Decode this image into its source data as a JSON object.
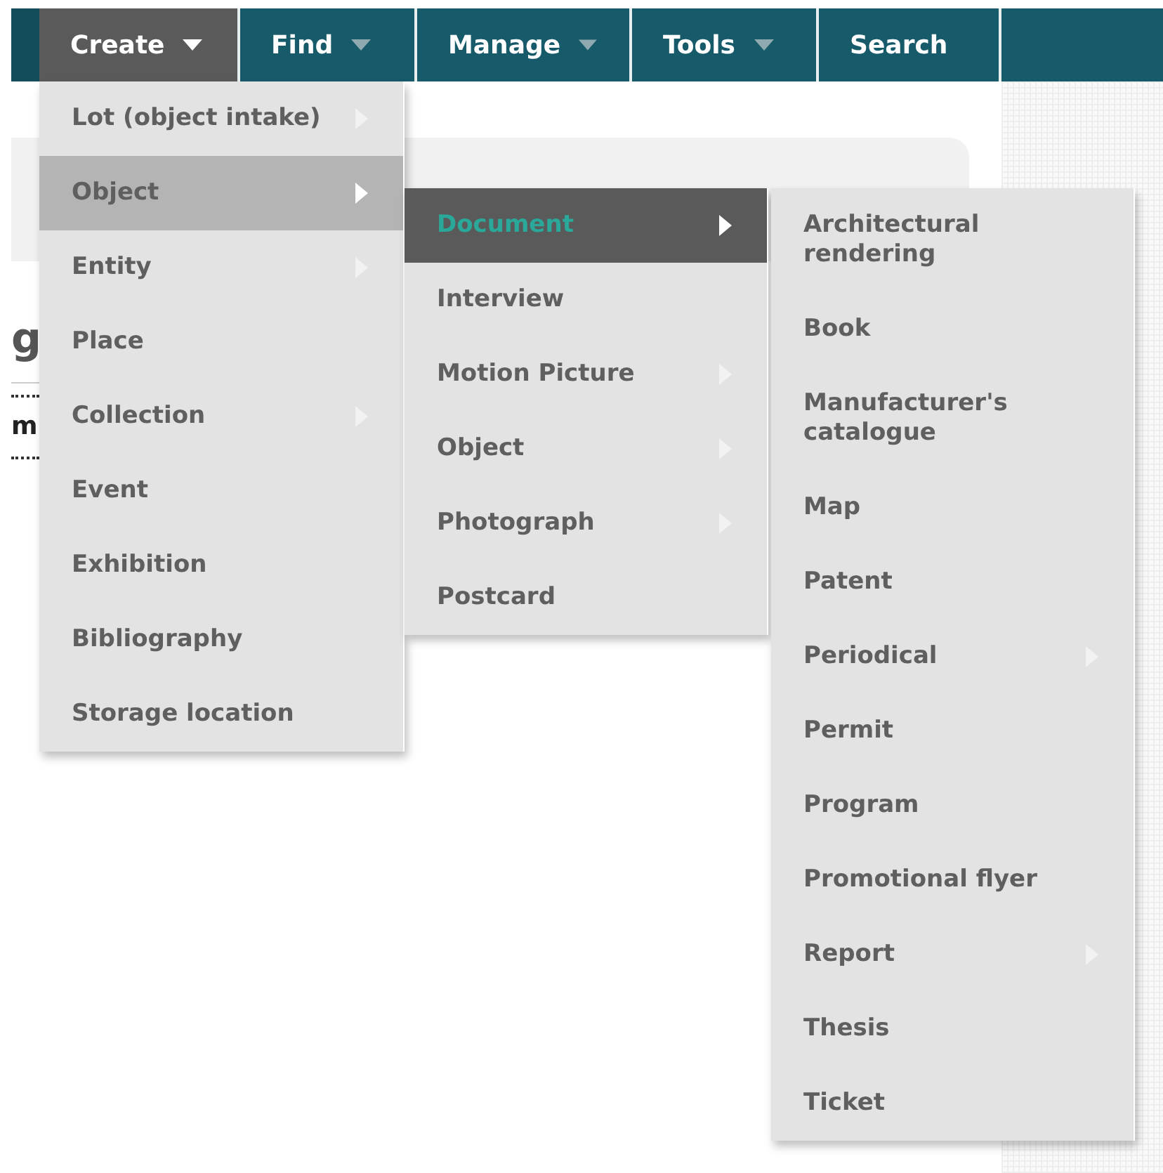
{
  "nav": {
    "tabs": [
      {
        "label": "Create",
        "selected": true,
        "dropdown": true
      },
      {
        "label": "Find",
        "selected": false,
        "dropdown": true
      },
      {
        "label": "Manage",
        "selected": false,
        "dropdown": true
      },
      {
        "label": "Tools",
        "selected": false,
        "dropdown": true
      },
      {
        "label": "Search",
        "selected": false,
        "dropdown": false
      }
    ]
  },
  "background": {
    "heading_fragment": "g",
    "label_fragment": "m"
  },
  "menus": [
    {
      "items": [
        {
          "label": "Lot (object intake)",
          "submenu": true,
          "selected": false
        },
        {
          "label": "Object",
          "submenu": true,
          "selected": true
        },
        {
          "label": "Entity",
          "submenu": true,
          "selected": false
        },
        {
          "label": "Place",
          "submenu": false,
          "selected": false
        },
        {
          "label": "Collection",
          "submenu": true,
          "selected": false
        },
        {
          "label": "Event",
          "submenu": false,
          "selected": false
        },
        {
          "label": "Exhibition",
          "submenu": false,
          "selected": false
        },
        {
          "label": "Bibliography",
          "submenu": false,
          "selected": false
        },
        {
          "label": "Storage location",
          "submenu": false,
          "selected": false
        }
      ]
    },
    {
      "items": [
        {
          "label": "Document",
          "submenu": true,
          "selected": true
        },
        {
          "label": "Interview",
          "submenu": false,
          "selected": false
        },
        {
          "label": "Motion Picture",
          "submenu": true,
          "selected": false
        },
        {
          "label": "Object",
          "submenu": true,
          "selected": false
        },
        {
          "label": "Photograph",
          "submenu": true,
          "selected": false
        },
        {
          "label": "Postcard",
          "submenu": false,
          "selected": false
        }
      ]
    },
    {
      "items": [
        {
          "label": "Architectural rendering",
          "submenu": false,
          "selected": false
        },
        {
          "label": "Book",
          "submenu": false,
          "selected": false
        },
        {
          "label": "Manufacturer's catalogue",
          "submenu": false,
          "selected": false
        },
        {
          "label": "Map",
          "submenu": false,
          "selected": false
        },
        {
          "label": "Patent",
          "submenu": false,
          "selected": false
        },
        {
          "label": "Periodical",
          "submenu": true,
          "selected": false
        },
        {
          "label": "Permit",
          "submenu": false,
          "selected": false
        },
        {
          "label": "Program",
          "submenu": false,
          "selected": false
        },
        {
          "label": "Promotional flyer",
          "submenu": false,
          "selected": false
        },
        {
          "label": "Report",
          "submenu": true,
          "selected": false
        },
        {
          "label": "Thesis",
          "submenu": false,
          "selected": false
        },
        {
          "label": "Ticket",
          "submenu": false,
          "selected": false
        }
      ]
    }
  ]
}
